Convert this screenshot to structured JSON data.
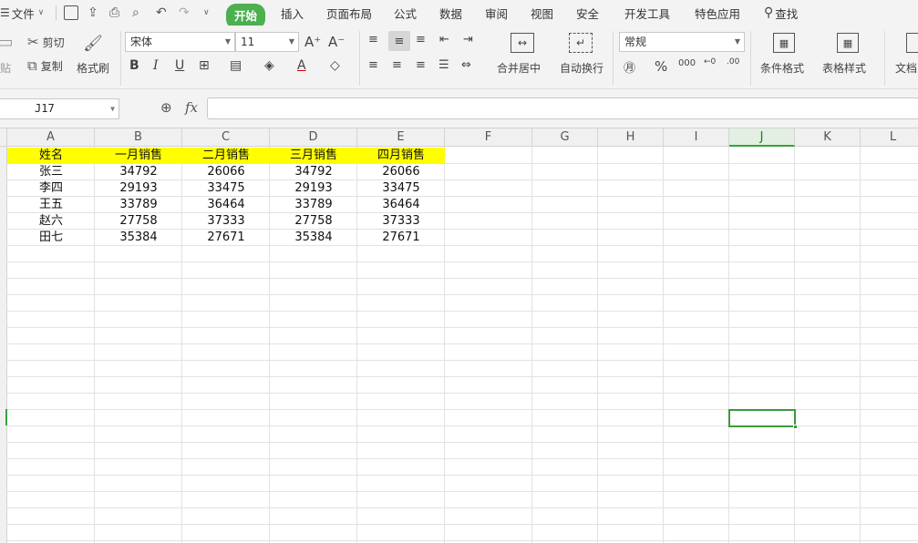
{
  "menubar": {
    "file_label": "文件",
    "tabs": [
      {
        "label": "开始",
        "active": true
      },
      {
        "label": "插入"
      },
      {
        "label": "页面布局"
      },
      {
        "label": "公式"
      },
      {
        "label": "数据"
      },
      {
        "label": "审阅"
      },
      {
        "label": "视图"
      },
      {
        "label": "安全"
      },
      {
        "label": "开发工具"
      },
      {
        "label": "特色应用"
      }
    ],
    "search_label": "查找",
    "accent_color": "#4caf50"
  },
  "ribbon": {
    "paste_label": "贴",
    "cut_label": "剪切",
    "copy_label": "复制",
    "format_painter_label": "格式刷",
    "font_name": "宋体",
    "font_size": "11",
    "merge_center_label": "合并居中",
    "wrap_text_label": "自动换行",
    "number_format": "常规",
    "conditional_format_label": "条件格式",
    "table_style_label": "表格样式",
    "doc_label": "文档"
  },
  "formula_bar": {
    "name_box": "J17",
    "fx_label": "fx",
    "value": ""
  },
  "sheet": {
    "columns": [
      "A",
      "B",
      "C",
      "D",
      "E",
      "F",
      "G",
      "H",
      "I",
      "J",
      "K",
      "L"
    ],
    "active_column": "J",
    "active_cell": "J17",
    "header_fill_color": "#ffff00",
    "header_row": [
      "姓名",
      "一月销售",
      "二月销售",
      "三月销售",
      "四月销售"
    ],
    "rows": [
      [
        "张三",
        "34792",
        "26066",
        "34792",
        "26066"
      ],
      [
        "李四",
        "29193",
        "33475",
        "29193",
        "33475"
      ],
      [
        "王五",
        "33789",
        "36464",
        "33789",
        "36464"
      ],
      [
        "赵六",
        "27758",
        "37333",
        "27758",
        "37333"
      ],
      [
        "田七",
        "35384",
        "27671",
        "35384",
        "27671"
      ]
    ]
  }
}
